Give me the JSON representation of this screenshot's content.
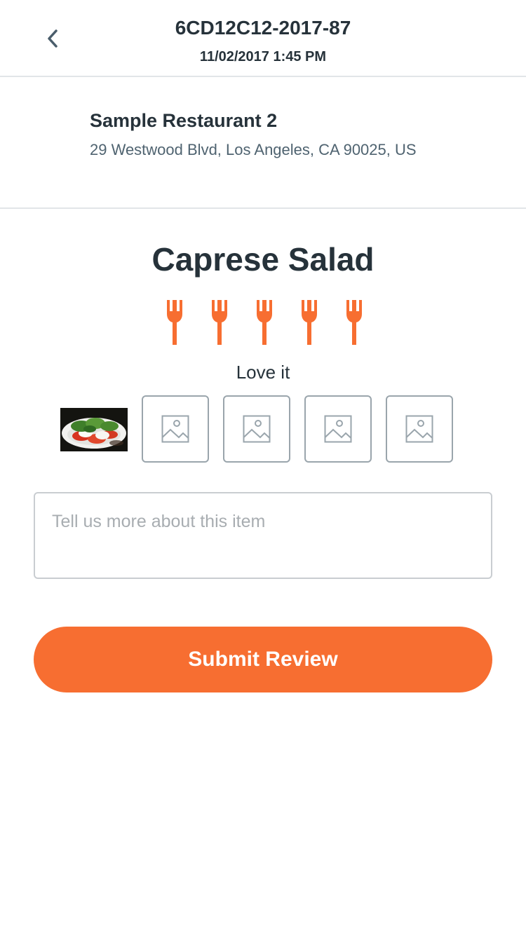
{
  "header": {
    "order_id": "6CD12C12-2017-87",
    "datetime": "11/02/2017 1:45 PM",
    "back_icon": "chevron-left-icon"
  },
  "restaurant": {
    "name": "Sample Restaurant 2",
    "address": "29 Westwood Blvd, Los Angeles, CA 90025, US"
  },
  "item": {
    "name": "Caprese Salad"
  },
  "rating": {
    "value": 5,
    "max": 5,
    "icon": "fork-icon",
    "label": "Love it"
  },
  "photos": {
    "attached": 1,
    "empty_slot_icon": "image-placeholder-icon",
    "empty_slots": 4
  },
  "review": {
    "value": "",
    "placeholder": "Tell us more about this item"
  },
  "submit": {
    "label": "Submit Review"
  },
  "colors": {
    "accent": "#f76e31",
    "text": "#26323a",
    "subtext": "#4f6370",
    "border": "#c9cdd1"
  }
}
